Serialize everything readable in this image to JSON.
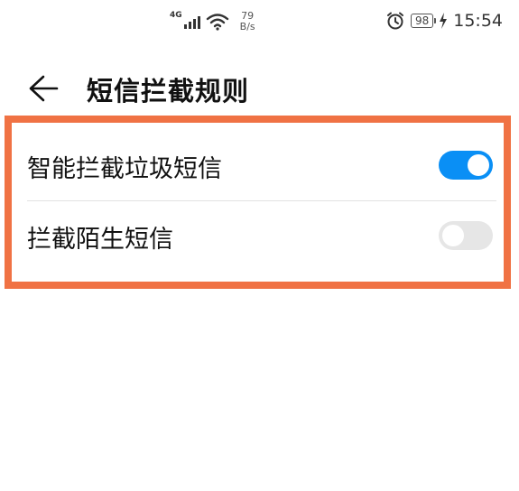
{
  "status_bar": {
    "network_type": "4G",
    "speed_value": "79",
    "speed_unit": "B/s",
    "battery": "98",
    "time": "15:54"
  },
  "header": {
    "title": "短信拦截规则"
  },
  "settings": [
    {
      "label": "智能拦截垃圾短信",
      "enabled": true
    },
    {
      "label": "拦截陌生短信",
      "enabled": false
    }
  ]
}
